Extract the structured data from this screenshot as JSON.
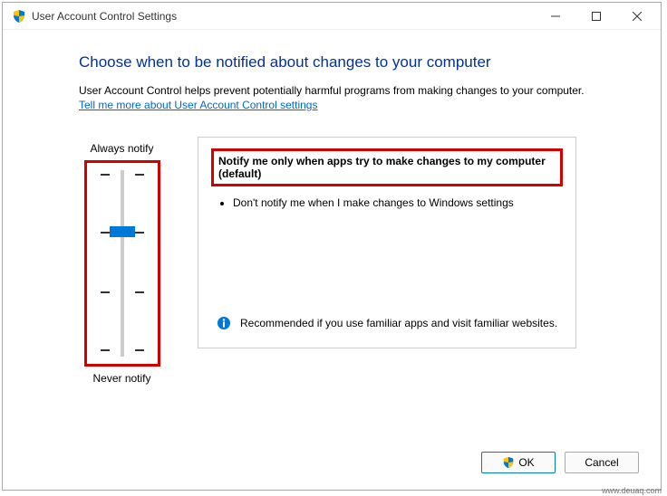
{
  "window": {
    "title": "User Account Control Settings"
  },
  "main": {
    "heading": "Choose when to be notified about changes to your computer",
    "description": "User Account Control helps prevent potentially harmful programs from making changes to your computer.",
    "help_link": "Tell me more about User Account Control settings"
  },
  "slider": {
    "top_label": "Always notify",
    "bottom_label": "Never notify",
    "level_count": 4,
    "selected_level": 2
  },
  "panel": {
    "title": "Notify me only when apps try to make changes to my computer (default)",
    "bullets": [
      "Don't notify me when I make changes to Windows settings"
    ],
    "recommendation": "Recommended if you use familiar apps and visit familiar websites."
  },
  "buttons": {
    "ok": "OK",
    "cancel": "Cancel"
  },
  "watermark": "www.deuaq.com"
}
